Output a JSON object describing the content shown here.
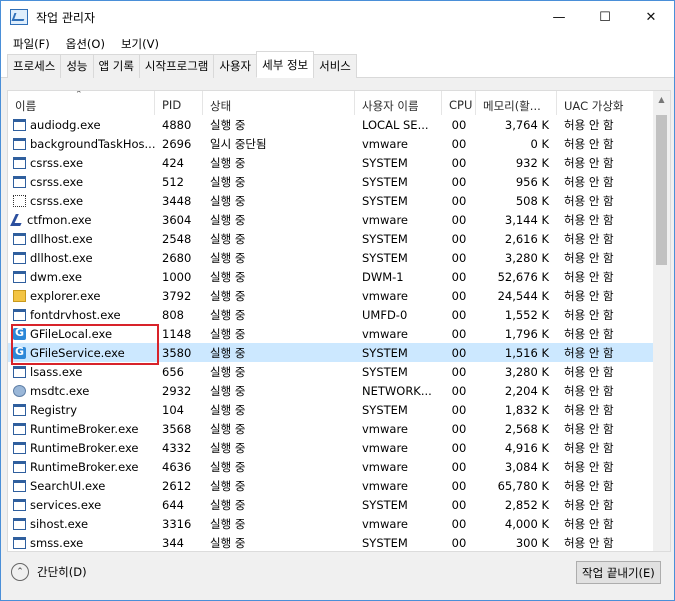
{
  "window": {
    "title": "작업 관리자",
    "minimize": "—",
    "maximize": "☐",
    "close": "✕"
  },
  "menu": [
    "파일(F)",
    "옵션(O)",
    "보기(V)"
  ],
  "tabs": [
    "프로세스",
    "성능",
    "앱 기록",
    "시작프로그램",
    "사용자",
    "세부 정보",
    "서비스"
  ],
  "active_tab": 5,
  "columns": {
    "name": "이름",
    "pid": "PID",
    "state": "상태",
    "user": "사용자 이름",
    "cpu": "CPU",
    "memory": "메모리(활...",
    "uac": "UAC 가상화"
  },
  "rows": [
    {
      "icon": "app",
      "name": "audiodg.exe",
      "pid": "4880",
      "state": "실행 중",
      "user": "LOCAL SE...",
      "cpu": "00",
      "mem": "3,764 K",
      "uac": "허용 안 함"
    },
    {
      "icon": "app",
      "name": "backgroundTaskHos...",
      "pid": "2696",
      "state": "일시 중단됨",
      "user": "vmware",
      "cpu": "00",
      "mem": "0 K",
      "uac": "허용 안 함"
    },
    {
      "icon": "app",
      "name": "csrss.exe",
      "pid": "424",
      "state": "실행 중",
      "user": "SYSTEM",
      "cpu": "00",
      "mem": "932 K",
      "uac": "허용 안 함"
    },
    {
      "icon": "app",
      "name": "csrss.exe",
      "pid": "512",
      "state": "실행 중",
      "user": "SYSTEM",
      "cpu": "00",
      "mem": "956 K",
      "uac": "허용 안 함"
    },
    {
      "icon": "dotted",
      "name": "csrss.exe",
      "pid": "3448",
      "state": "실행 중",
      "user": "SYSTEM",
      "cpu": "00",
      "mem": "508 K",
      "uac": "허용 안 함"
    },
    {
      "icon": "pen",
      "name": "ctfmon.exe",
      "pid": "3604",
      "state": "실행 중",
      "user": "vmware",
      "cpu": "00",
      "mem": "3,144 K",
      "uac": "허용 안 함"
    },
    {
      "icon": "app",
      "name": "dllhost.exe",
      "pid": "2548",
      "state": "실행 중",
      "user": "SYSTEM",
      "cpu": "00",
      "mem": "2,616 K",
      "uac": "허용 안 함"
    },
    {
      "icon": "app",
      "name": "dllhost.exe",
      "pid": "2680",
      "state": "실행 중",
      "user": "SYSTEM",
      "cpu": "00",
      "mem": "3,280 K",
      "uac": "허용 안 함"
    },
    {
      "icon": "app",
      "name": "dwm.exe",
      "pid": "1000",
      "state": "실행 중",
      "user": "DWM-1",
      "cpu": "00",
      "mem": "52,676 K",
      "uac": "허용 안 함"
    },
    {
      "icon": "explorer",
      "name": "explorer.exe",
      "pid": "3792",
      "state": "실행 중",
      "user": "vmware",
      "cpu": "00",
      "mem": "24,544 K",
      "uac": "허용 안 함"
    },
    {
      "icon": "app",
      "name": "fontdrvhost.exe",
      "pid": "808",
      "state": "실행 중",
      "user": "UMFD-0",
      "cpu": "00",
      "mem": "1,552 K",
      "uac": "허용 안 함"
    },
    {
      "icon": "gfile",
      "name": "GFileLocal.exe",
      "pid": "1148",
      "state": "실행 중",
      "user": "vmware",
      "cpu": "00",
      "mem": "1,796 K",
      "uac": "허용 안 함"
    },
    {
      "icon": "gfile",
      "name": "GFileService.exe",
      "pid": "3580",
      "state": "실행 중",
      "user": "SYSTEM",
      "cpu": "00",
      "mem": "1,516 K",
      "uac": "허용 안 함",
      "selected": true
    },
    {
      "icon": "app",
      "name": "lsass.exe",
      "pid": "656",
      "state": "실행 중",
      "user": "SYSTEM",
      "cpu": "00",
      "mem": "3,280 K",
      "uac": "허용 안 함"
    },
    {
      "icon": "msdtc",
      "name": "msdtc.exe",
      "pid": "2932",
      "state": "실행 중",
      "user": "NETWORK...",
      "cpu": "00",
      "mem": "2,204 K",
      "uac": "허용 안 함"
    },
    {
      "icon": "app",
      "name": "Registry",
      "pid": "104",
      "state": "실행 중",
      "user": "SYSTEM",
      "cpu": "00",
      "mem": "1,832 K",
      "uac": "허용 안 함"
    },
    {
      "icon": "app",
      "name": "RuntimeBroker.exe",
      "pid": "3568",
      "state": "실행 중",
      "user": "vmware",
      "cpu": "00",
      "mem": "2,568 K",
      "uac": "허용 안 함"
    },
    {
      "icon": "app",
      "name": "RuntimeBroker.exe",
      "pid": "4332",
      "state": "실행 중",
      "user": "vmware",
      "cpu": "00",
      "mem": "4,916 K",
      "uac": "허용 안 함"
    },
    {
      "icon": "app",
      "name": "RuntimeBroker.exe",
      "pid": "4636",
      "state": "실행 중",
      "user": "vmware",
      "cpu": "00",
      "mem": "3,084 K",
      "uac": "허용 안 함"
    },
    {
      "icon": "app",
      "name": "SearchUI.exe",
      "pid": "2612",
      "state": "실행 중",
      "user": "vmware",
      "cpu": "00",
      "mem": "65,780 K",
      "uac": "허용 안 함"
    },
    {
      "icon": "app",
      "name": "services.exe",
      "pid": "644",
      "state": "실행 중",
      "user": "SYSTEM",
      "cpu": "00",
      "mem": "2,852 K",
      "uac": "허용 안 함"
    },
    {
      "icon": "app",
      "name": "sihost.exe",
      "pid": "3316",
      "state": "실행 중",
      "user": "vmware",
      "cpu": "00",
      "mem": "4,000 K",
      "uac": "허용 안 함"
    },
    {
      "icon": "app",
      "name": "smss.exe",
      "pid": "344",
      "state": "실행 중",
      "user": "SYSTEM",
      "cpu": "00",
      "mem": "300 K",
      "uac": "허용 안 함"
    }
  ],
  "footer": {
    "fewer_details": "간단히(D)",
    "end_task": "작업 끝내기(E)"
  },
  "colors": {
    "selected_row": "#cce8ff",
    "highlight_box": "#d8232a"
  }
}
